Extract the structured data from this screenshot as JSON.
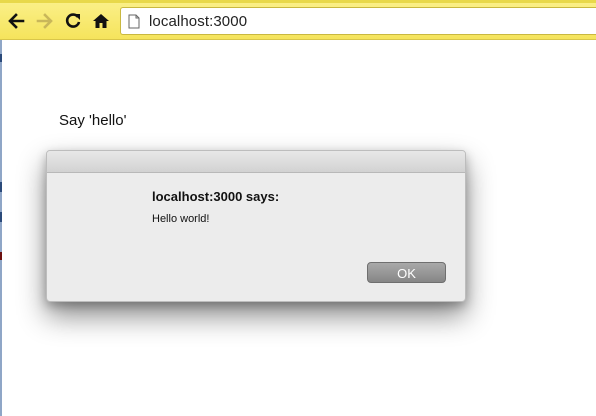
{
  "browser": {
    "address": "localhost:3000",
    "icons": {
      "back": "arrow-left-icon",
      "forward": "arrow-right-icon",
      "reload": "reload-icon",
      "home": "home-icon",
      "page": "page-icon"
    }
  },
  "page": {
    "text": "Say 'hello'"
  },
  "dialog": {
    "heading": "localhost:3000 says:",
    "message": "Hello world!",
    "ok_label": "OK"
  },
  "colors": {
    "toolbar": "#f5e45c",
    "dialog_bg": "#ececec",
    "ok_button": "#969696"
  }
}
